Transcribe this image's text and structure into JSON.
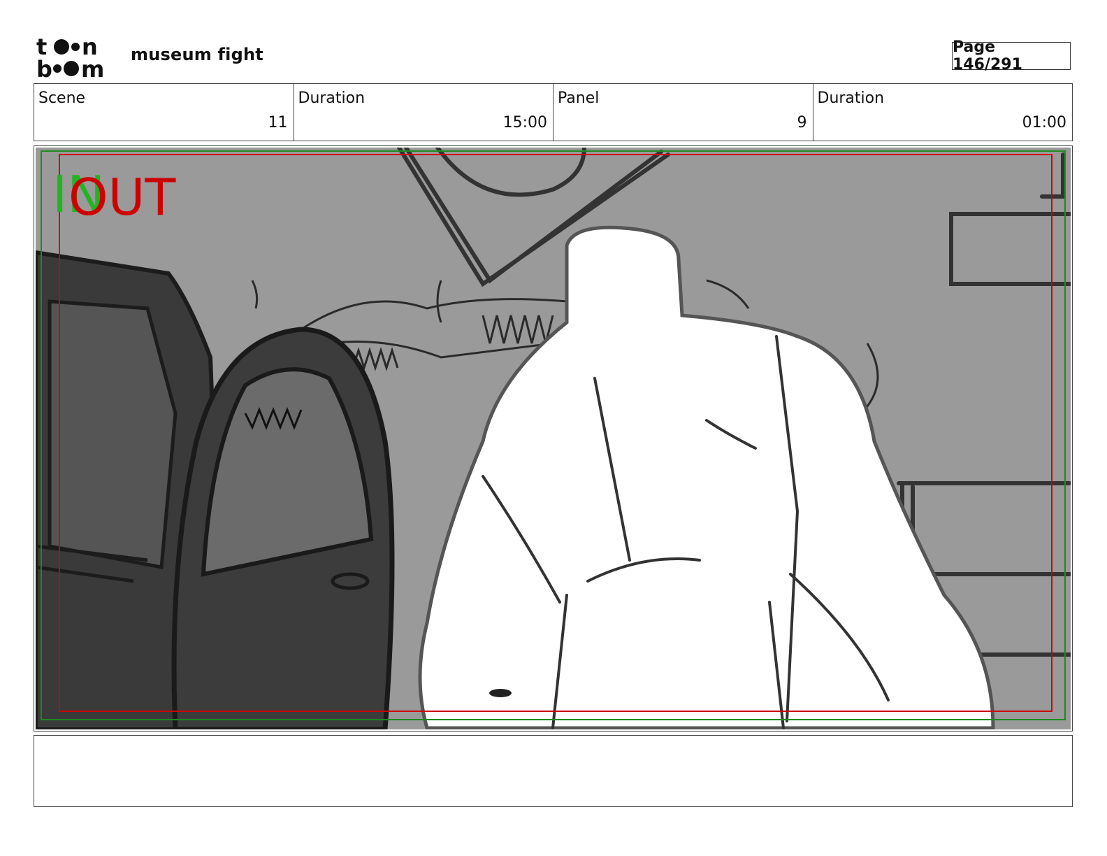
{
  "header": {
    "logo_text": "toon boom",
    "project_title": "museum fight",
    "page_counter": "Page 146/291"
  },
  "info": [
    {
      "label": "Scene",
      "value": "11"
    },
    {
      "label": "Duration",
      "value": "15:00"
    },
    {
      "label": "Panel",
      "value": "9"
    },
    {
      "label": "Duration",
      "value": "01:00"
    }
  ],
  "panel": {
    "in_marker": "IN",
    "out_marker": "OUT",
    "colors": {
      "in": "#22b422",
      "out": "#cc0000",
      "background": "#999999",
      "car": "#3a3a3a"
    }
  },
  "notes": {
    "text": ""
  }
}
